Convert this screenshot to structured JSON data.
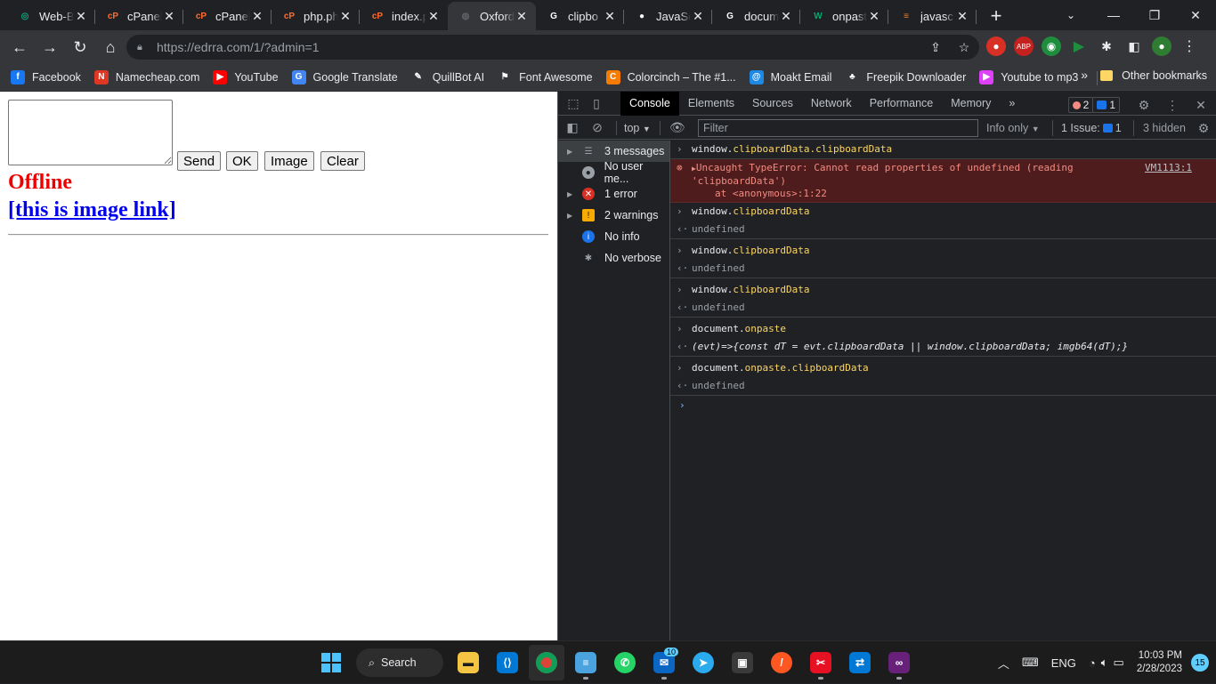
{
  "browser": {
    "tabs": [
      {
        "title": "Web-B",
        "icon": "chatgpt-icon",
        "color": "#10a37f",
        "glyph": "◎"
      },
      {
        "title": "cPanel",
        "icon": "cpanel-icon",
        "color": "#ff6c2c",
        "glyph": "cP"
      },
      {
        "title": "cPanel",
        "icon": "cpanel-icon",
        "color": "#ff6c2c",
        "glyph": "cP"
      },
      {
        "title": "php.ph",
        "icon": "cpanel-icon",
        "color": "#ff6c2c",
        "glyph": "cP"
      },
      {
        "title": "index.p",
        "icon": "cpanel-icon",
        "color": "#ff6c2c",
        "glyph": "cP"
      },
      {
        "title": "Oxford",
        "icon": "globe-icon",
        "color": "#5f6368",
        "glyph": "◍"
      },
      {
        "title": "clipbo",
        "icon": "google-icon",
        "color": "#ffffff",
        "glyph": "G"
      },
      {
        "title": "JavaSc",
        "icon": "github-icon",
        "color": "#ffffff",
        "glyph": "●"
      },
      {
        "title": "docum",
        "icon": "google-icon",
        "color": "#ffffff",
        "glyph": "G"
      },
      {
        "title": "onpast",
        "icon": "w3schools-icon",
        "color": "#04aa6d",
        "glyph": "W"
      },
      {
        "title": "javasc",
        "icon": "stackoverflow-icon",
        "color": "#f48024",
        "glyph": "≡"
      }
    ],
    "close_glyph": "✕",
    "new_tab_glyph": "+",
    "url_host": "https://edrra.com",
    "url_path": "/1/?admin=1",
    "bookmarks": [
      {
        "label": "Facebook",
        "icon": "facebook-icon",
        "color": "#1877f2",
        "glyph": "f"
      },
      {
        "label": "Namecheap.com",
        "icon": "namecheap-icon",
        "color": "#de3723",
        "glyph": "N"
      },
      {
        "label": "YouTube",
        "icon": "youtube-icon",
        "color": "#ff0000",
        "glyph": "▶"
      },
      {
        "label": "Google Translate",
        "icon": "google-translate-icon",
        "color": "#4285f4",
        "glyph": "G"
      },
      {
        "label": "QuillBot AI",
        "icon": "quill-icon",
        "color": "#35363a",
        "glyph": "✎"
      },
      {
        "label": "Font Awesome",
        "icon": "flag-icon",
        "color": "#35363a",
        "glyph": "⚑"
      },
      {
        "label": "Colorcinch – The #1...",
        "icon": "colorcinch-icon",
        "color": "#f57c00",
        "glyph": "C"
      },
      {
        "label": "Moakt Email",
        "icon": "moakt-icon",
        "color": "#1e88e5",
        "glyph": "@"
      },
      {
        "label": "Freepik Downloader",
        "icon": "freepik-icon",
        "color": "#35363a",
        "glyph": "♣"
      },
      {
        "label": "Youtube to mp3",
        "icon": "yt-mp3-icon",
        "color": "#e040fb",
        "glyph": "▶"
      }
    ],
    "bookmarks_more": "»",
    "other_bookmarks": "Other bookmarks"
  },
  "page": {
    "buttons": {
      "send": "Send",
      "ok": "OK",
      "image": "Image",
      "clear": "Clear"
    },
    "status": "Offline",
    "image_link": "[this is image link]"
  },
  "devtools": {
    "tabs": [
      "Console",
      "Elements",
      "Sources",
      "Network",
      "Performance",
      "Memory"
    ],
    "more_tabs": "»",
    "error_count": "2",
    "info_count": "1",
    "context": "top",
    "filter_placeholder": "Filter",
    "levels": "Info only",
    "issues": "1 Issue:",
    "issues_count": "1",
    "hidden": "3 hidden",
    "sidebar": [
      {
        "label": "3 messages",
        "icon": "list-icon"
      },
      {
        "label": "No user me...",
        "icon": "user-icon"
      },
      {
        "label": "1 error",
        "icon": "error-icon"
      },
      {
        "label": "2 warnings",
        "icon": "warning-icon"
      },
      {
        "label": "No info",
        "icon": "info-icon"
      },
      {
        "label": "No verbose",
        "icon": "bug-icon"
      }
    ],
    "console": {
      "l1_obj": "window.",
      "l1_prop": "clipboardData.clipboardData",
      "err_msg": "Uncaught TypeError: Cannot read properties of undefined (reading",
      "err_msg2": "'clipboardData')",
      "err_stack": "at <anonymous>:1:22",
      "err_src": "VM1113:1",
      "obj_window": "window.",
      "prop_clip": "clipboardData",
      "undefined": "undefined",
      "obj_document": "document.",
      "prop_onpaste": "onpaste",
      "prop_onpaste_clip": "onpaste.clipboardData",
      "fn_value": "(evt)=>{const dT = evt.clipboardData || window.clipboardData; imgb64(dT);}"
    }
  },
  "taskbar": {
    "search": "Search",
    "mail_badge": "10",
    "lang": "ENG",
    "time": "10:03 PM",
    "date": "2/28/2023",
    "notifications": "15"
  }
}
